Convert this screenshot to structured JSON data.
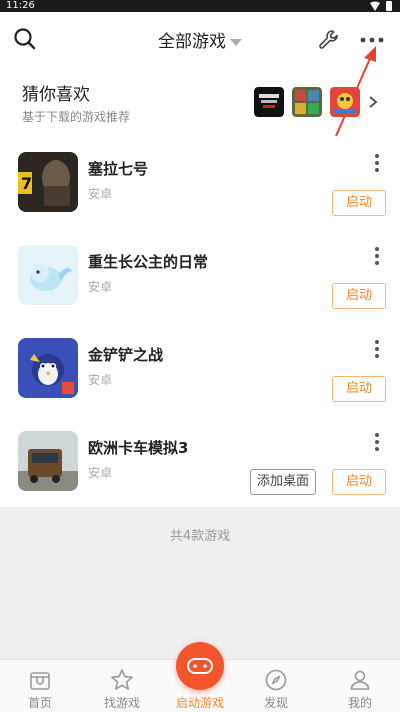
{
  "status_bar": {
    "time": "11:26"
  },
  "header": {
    "title": "全部游戏"
  },
  "recommend": {
    "title": "猜你喜欢",
    "subtitle": "基于下载的游戏推荐"
  },
  "games": [
    {
      "name": "塞拉七号",
      "platform": "安卓",
      "launch_label": "启动"
    },
    {
      "name": "重生长公主的日常",
      "platform": "安卓",
      "launch_label": "启动"
    },
    {
      "name": "金铲铲之战",
      "platform": "安卓",
      "launch_label": "启动"
    },
    {
      "name": "欧洲卡车模拟3",
      "platform": "安卓",
      "launch_label": "启动",
      "add_desktop_label": "添加桌面"
    }
  ],
  "summary": {
    "count_text": "共4款游戏"
  },
  "bottom_nav": [
    {
      "label": "首页",
      "icon": "home-icon"
    },
    {
      "label": "找游戏",
      "icon": "star-icon"
    },
    {
      "label": "启动游戏",
      "icon": "gamepad-icon",
      "active": true
    },
    {
      "label": "发现",
      "icon": "compass-icon"
    },
    {
      "label": "我的",
      "icon": "profile-icon"
    }
  ],
  "colors": {
    "accent": "#f28a2e",
    "fab": "#f2552c",
    "annotation": "#e8412f"
  }
}
